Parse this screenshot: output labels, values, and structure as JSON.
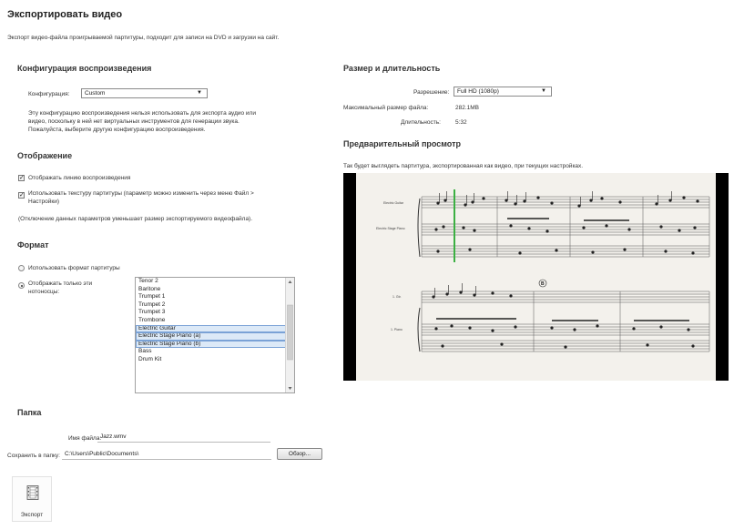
{
  "page": {
    "title": "Экспортировать видео",
    "description": "Экспорт видео-файла проигрываемой партитуры, подходит для записи на DVD и загрузки на сайт."
  },
  "playback": {
    "heading": "Конфигурация воспроизведения",
    "config_label": "Конфигурация:",
    "config_value": "Custom",
    "note_lines": [
      "Эту конфигурацию воспроизведения нельзя использовать для экспорта аудио или",
      "видео, поскольку в ней нет виртуальных инструментов для генерации звука.",
      "Пожалуйста, выберите другую конфигурацию воспроизведения."
    ]
  },
  "display": {
    "heading": "Отображение",
    "show_playline_label": "Отображать линию воспроизведения",
    "show_playline_checked": true,
    "use_texture_label_1": "Использовать текстуру партитуры (параметр можно изменить через меню Файл >",
    "use_texture_label_2": "Настройки)",
    "use_texture_checked": true,
    "note": "(Отключение данных параметров уменьшает размер экспортируемого видеофайла)."
  },
  "format": {
    "heading": "Формат",
    "use_score_format_label": "Использовать формат партитуры",
    "show_only_label_1": "Отображать только эти",
    "show_only_label_2": "нотоносцы:",
    "selected_option": "show_only",
    "staves": [
      {
        "name": "Tenor 2",
        "selected": false
      },
      {
        "name": "Baritone",
        "selected": false
      },
      {
        "name": "Trumpet 1",
        "selected": false
      },
      {
        "name": "Trumpet 2",
        "selected": false
      },
      {
        "name": "Trumpet 3",
        "selected": false
      },
      {
        "name": "Trombone",
        "selected": false
      },
      {
        "name": "Electric Guitar",
        "selected": true
      },
      {
        "name": "Electric Stage Piano (a)",
        "selected": true
      },
      {
        "name": "Electric Stage Piano (b)",
        "selected": true
      },
      {
        "name": "Bass",
        "selected": false
      },
      {
        "name": "Drum Kit",
        "selected": false
      }
    ]
  },
  "folder": {
    "heading": "Папка",
    "filename_label": "Имя файла:",
    "filename_value": "Jazz.wmv",
    "save_to_label": "Сохранить в папку:",
    "save_to_value": "C:\\Users\\Public\\Documents\\",
    "browse_label": "Обзор..."
  },
  "size": {
    "heading": "Размер и длительность",
    "resolution_label": "Разрешение:",
    "resolution_value": "Full HD (1080p)",
    "max_size_label": "Максимальный размер файла:",
    "max_size_value": "282.1MB",
    "duration_label": "Длительность:",
    "duration_value": "5:32"
  },
  "preview": {
    "heading": "Предварительный просмотр",
    "caption": "Так будет выглядеть партитура, экспортированная как видео, при текущих настройках.",
    "staff_labels": [
      "Electric Guitar",
      "Electric Stage Piano",
      "1. Gtr.",
      "1. Piano"
    ],
    "rehearsal_mark": "B",
    "playline_color": "#3cb043"
  },
  "export": {
    "label": "Экспорт",
    "icon": "film-strip-icon"
  }
}
